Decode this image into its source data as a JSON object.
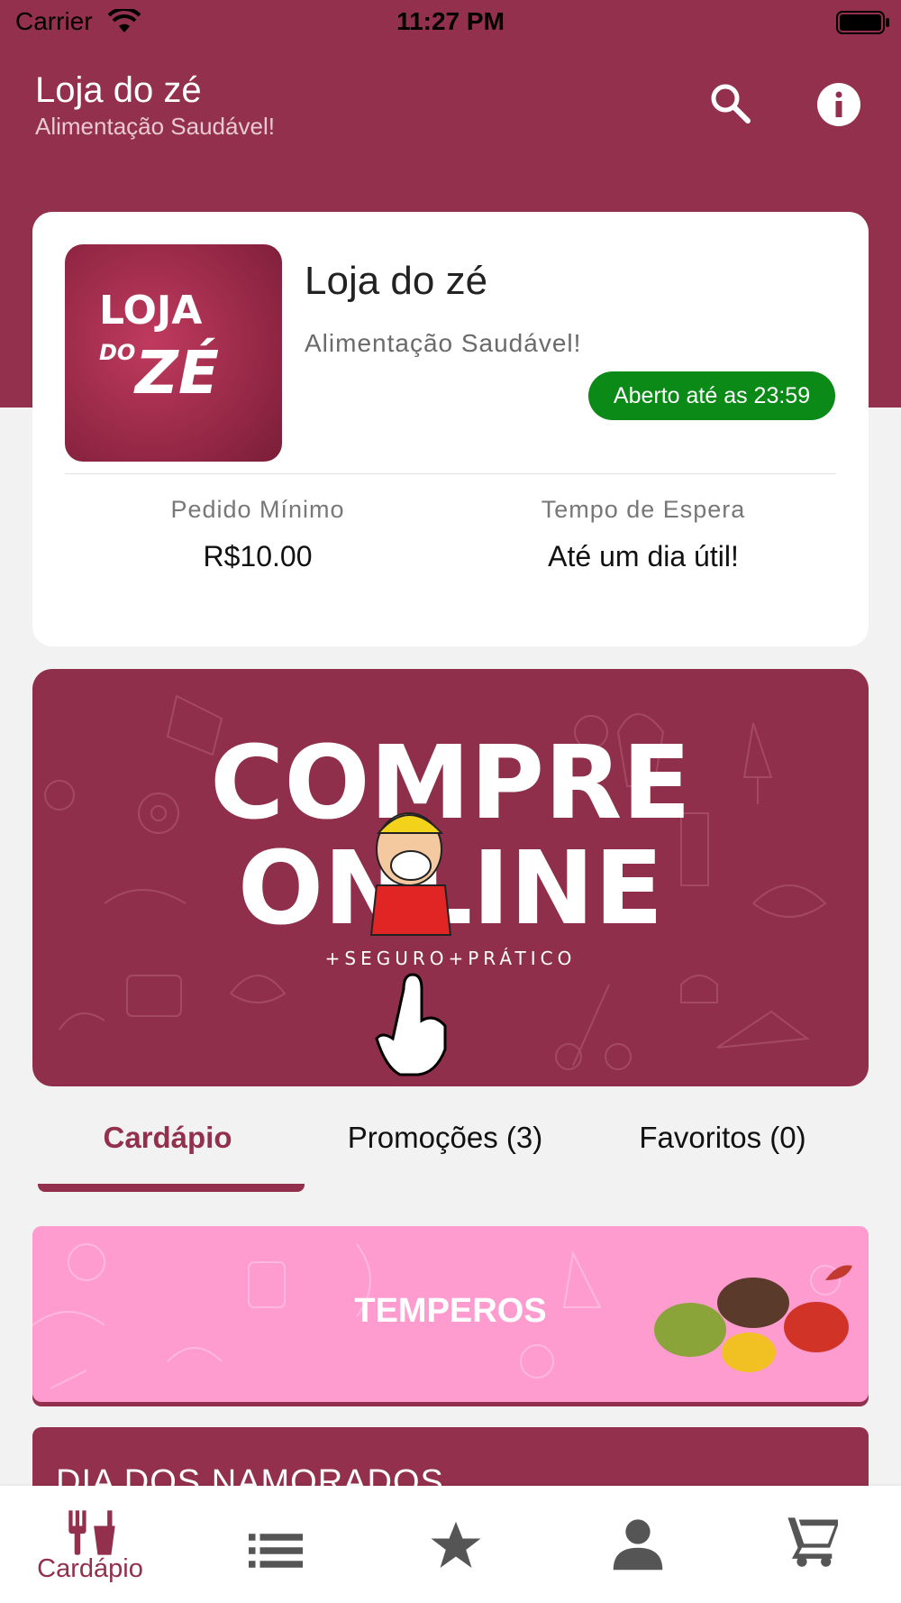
{
  "status": {
    "carrier": "Carrier",
    "time": "11:27 PM"
  },
  "header": {
    "title": "Loja do zé",
    "subtitle": "Alimentação Saudável!"
  },
  "store": {
    "logo_text_line1": "LOJA",
    "logo_text_do": "DO",
    "logo_text_ze": "ZÉ",
    "name": "Loja do zé",
    "subtitle": "Alimentação Saudável!",
    "open_badge": "Aberto até as 23:59",
    "min_order_label": "Pedido Mínimo",
    "min_order_value": "R$10.00",
    "wait_label": "Tempo de Espera",
    "wait_value": "Até um dia útil!"
  },
  "banner": {
    "line1": "COMPRE",
    "line2": "ONLINE",
    "tagline": "+SEGURO+PRÁTICO"
  },
  "tabs": [
    {
      "label": "Cardápio",
      "active": true
    },
    {
      "label": "Promoções (3)",
      "active": false
    },
    {
      "label": "Favoritos (0)",
      "active": false
    }
  ],
  "categories": [
    {
      "label": "TEMPEROS"
    },
    {
      "label": "DIA DOS NAMORADOS"
    }
  ],
  "bottom_nav": [
    {
      "icon": "restaurant-icon",
      "label": "Cardápio",
      "active": true
    },
    {
      "icon": "list-icon",
      "label": ""
    },
    {
      "icon": "star-icon",
      "label": ""
    },
    {
      "icon": "person-icon",
      "label": ""
    },
    {
      "icon": "cart-icon",
      "label": ""
    }
  ],
  "colors": {
    "primary": "#92304d",
    "open_green": "#0b8a17",
    "category_pink": "#ff9ccf"
  }
}
